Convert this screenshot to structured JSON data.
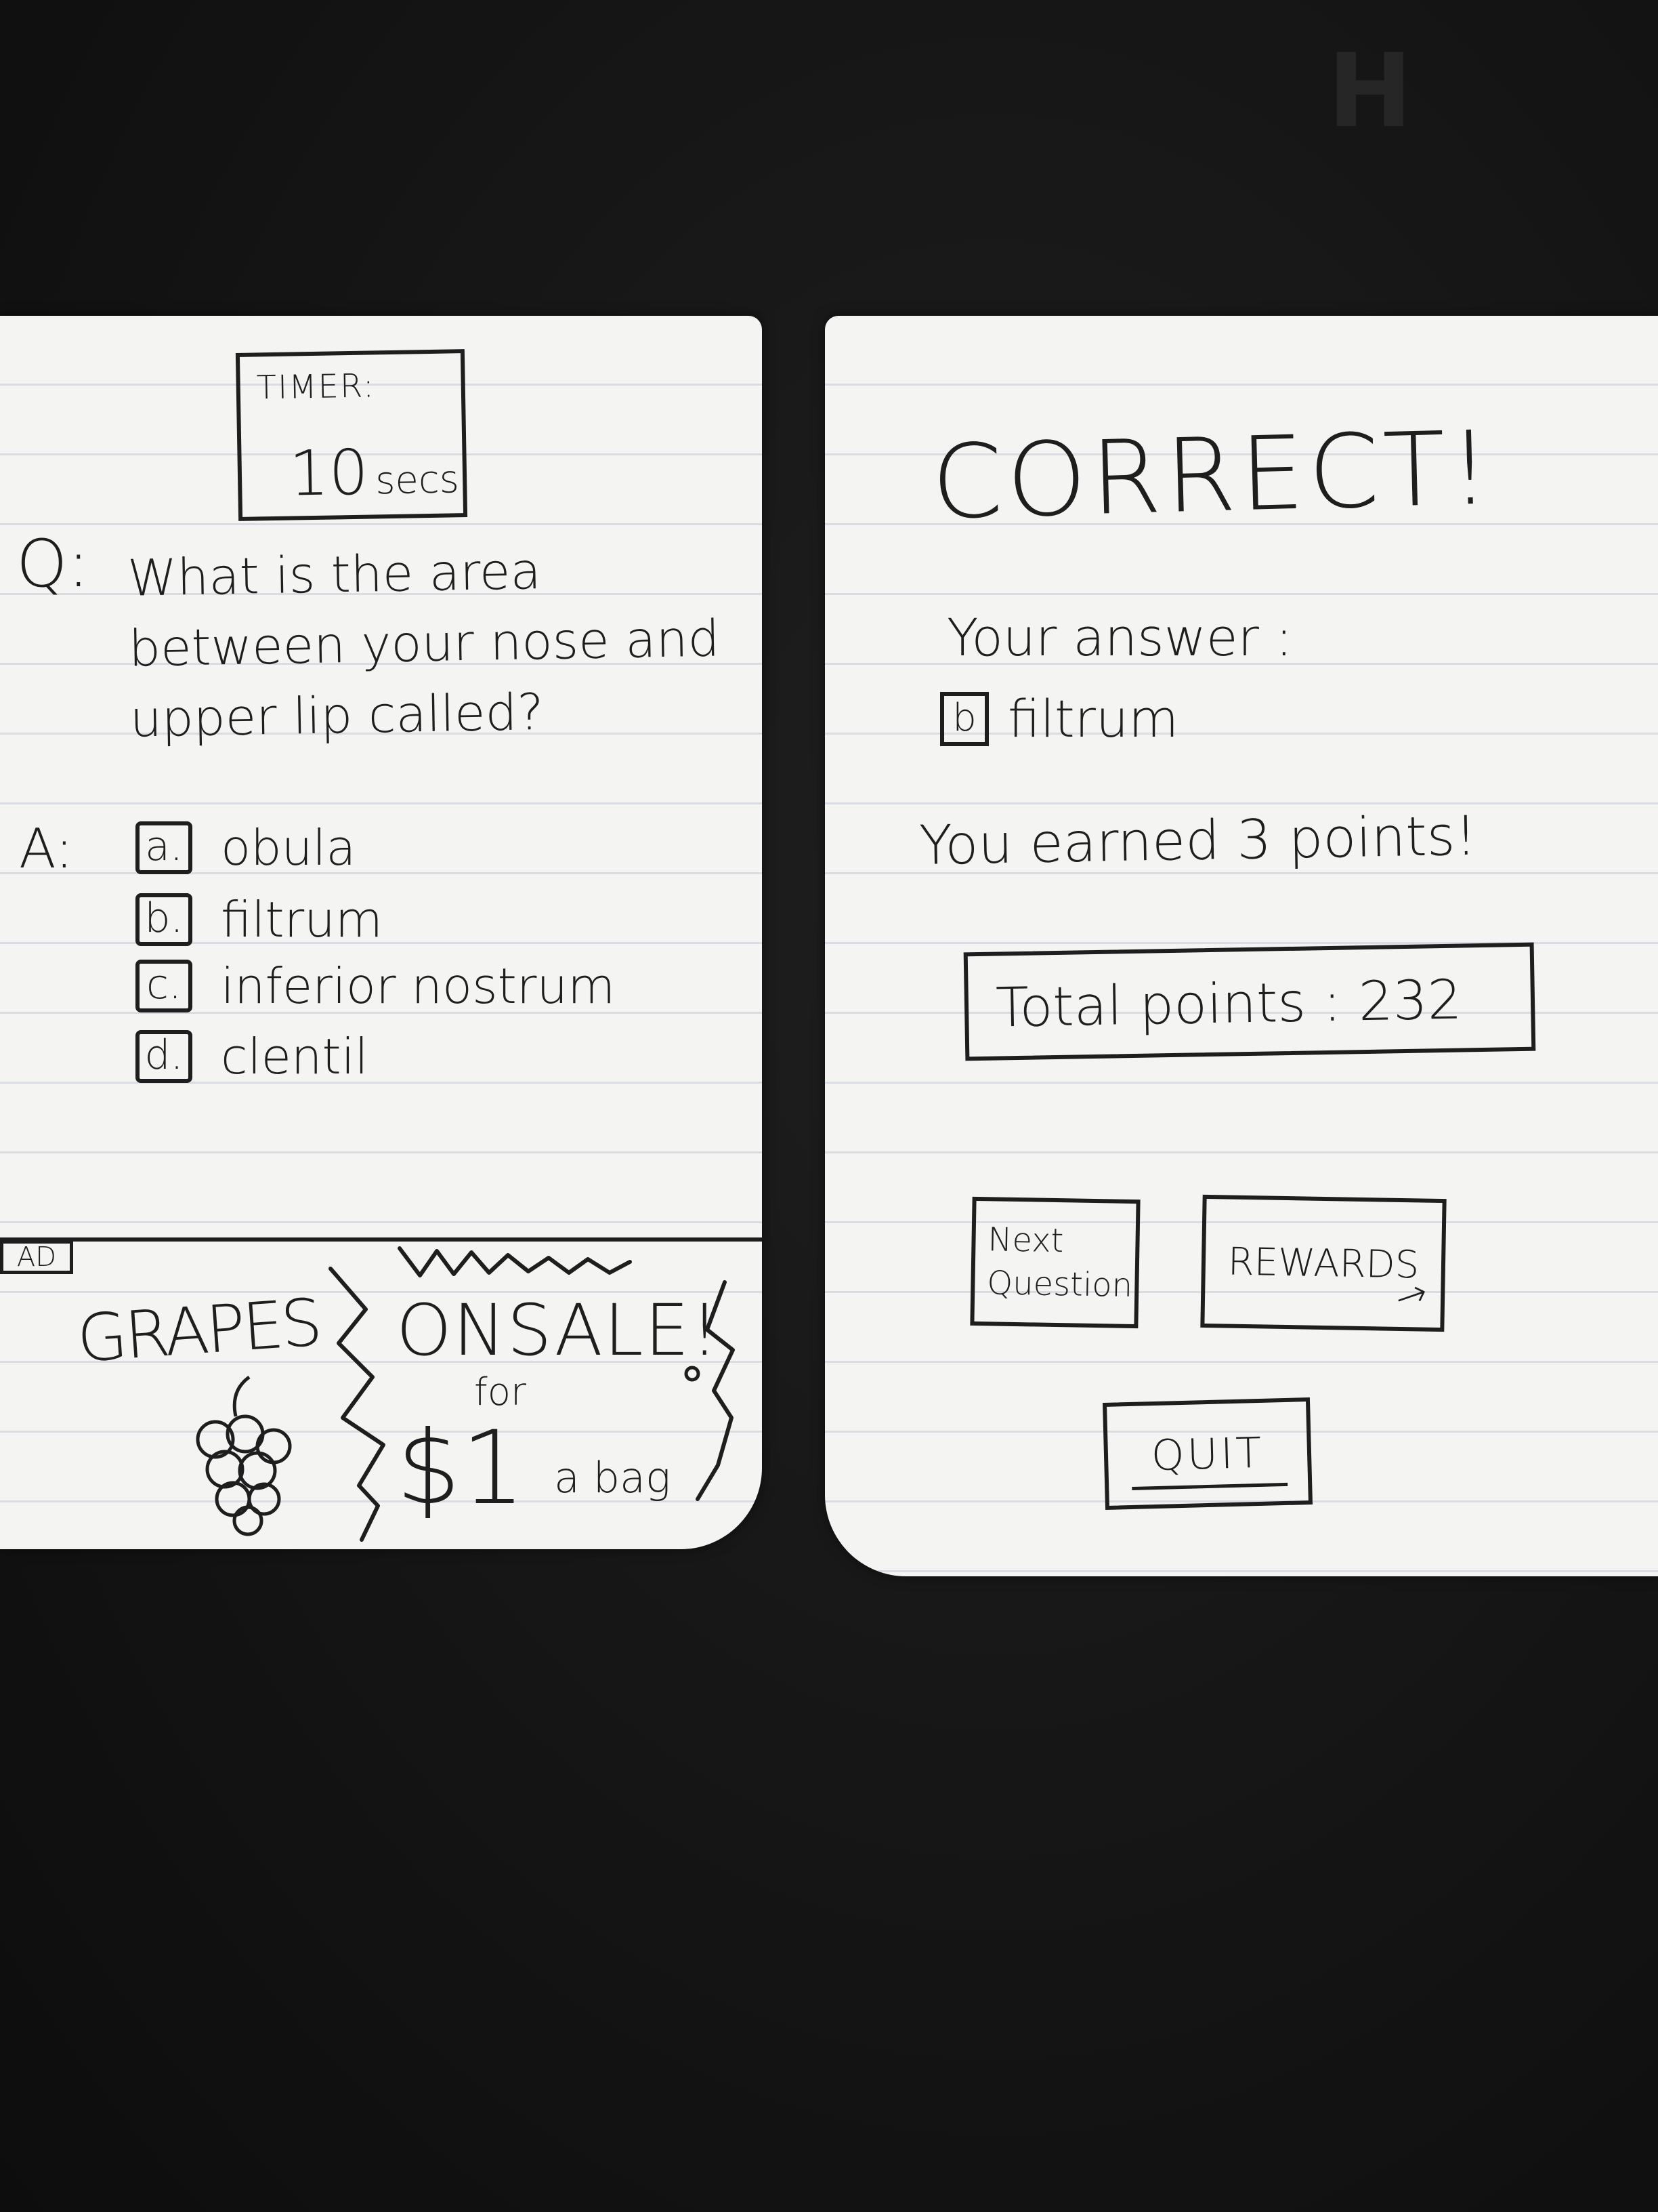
{
  "corner_mark": "H",
  "quiz_screen": {
    "timer": {
      "label": "TIMER:",
      "value": "10",
      "unit": "secs"
    },
    "question": {
      "prefix": "Q:",
      "text": "What is the area between your nose and upper lip called?"
    },
    "answers_prefix": "A:",
    "answers": [
      {
        "key": "a.",
        "text": "obula"
      },
      {
        "key": "b.",
        "text": "filtrum"
      },
      {
        "key": "c.",
        "text": "inferior nostrum"
      },
      {
        "key": "d.",
        "text": "clentil"
      }
    ],
    "ad": {
      "tag": "AD",
      "product": "GRAPES",
      "headline": "ONSALE!",
      "for": "for",
      "price": "$1",
      "unit": "a bag"
    }
  },
  "result_screen": {
    "title": "CORRECT!",
    "your_answer_label": "Your answer :",
    "selected_answer": {
      "key": "b",
      "text": "filtrum"
    },
    "earned": "You earned 3 points!",
    "total_points": "Total points : 232",
    "buttons": {
      "next_line1": "Next",
      "next_line2": "Question",
      "rewards": "REWARDS",
      "rewards_arrow": "→",
      "quit": "QUIT"
    }
  },
  "colors": {
    "ink": "#1e1e1e",
    "paper": "#f4f4f2",
    "rule_lines": "#d9dde2",
    "background": "#141414"
  }
}
